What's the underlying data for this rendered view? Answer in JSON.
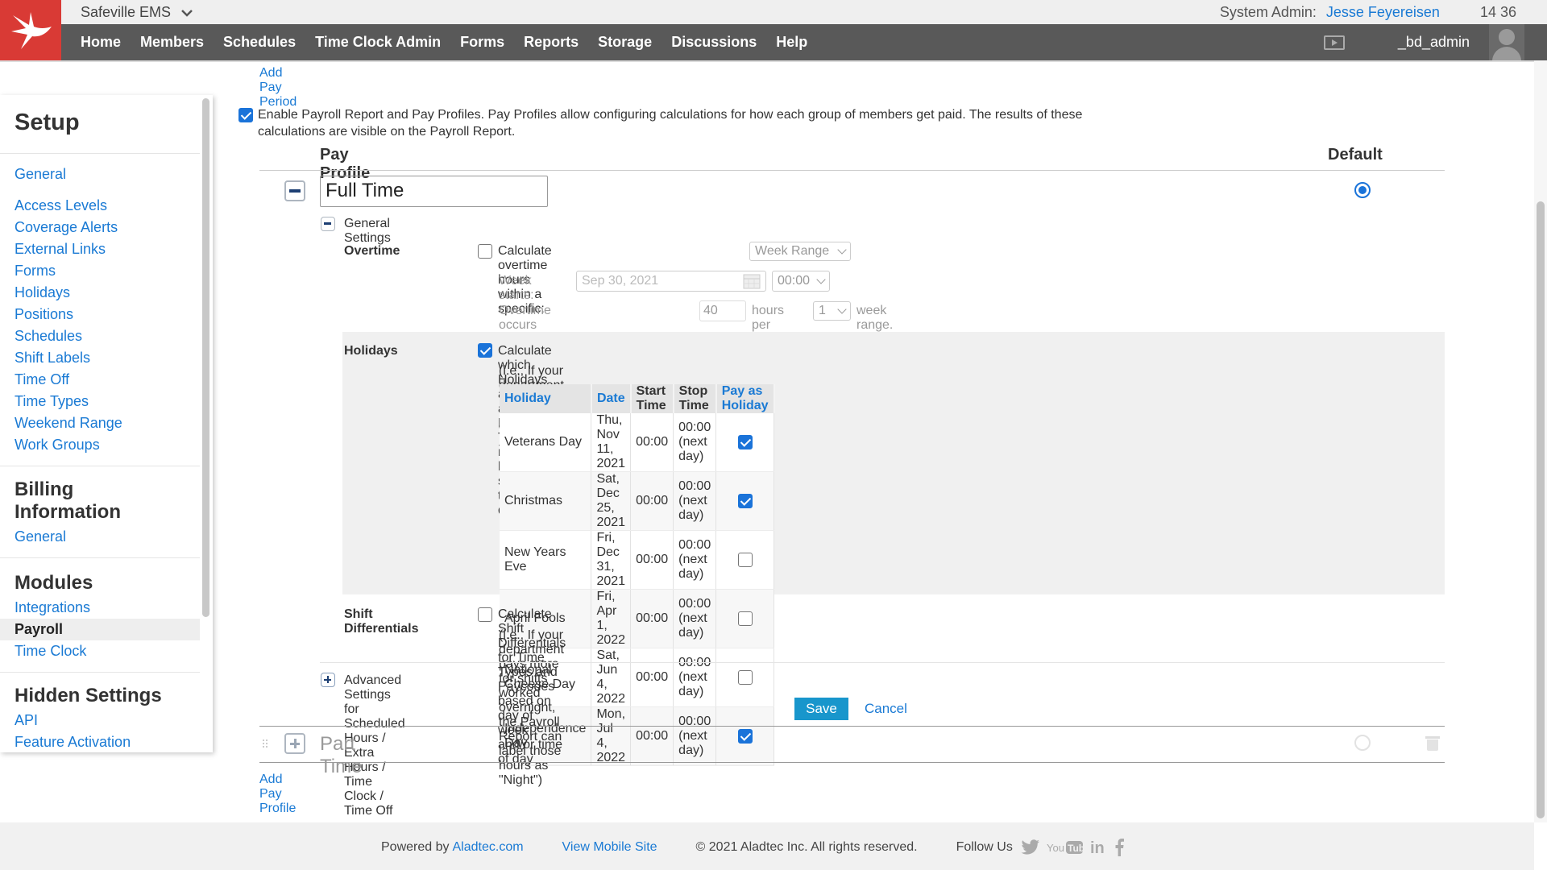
{
  "topbar": {
    "org_name": "Safeville EMS",
    "admin_label": "System Admin:",
    "admin_name": "Jesse Feyereisen",
    "time": "14 36"
  },
  "nav": {
    "items": [
      "Home",
      "Members",
      "Schedules",
      "Time Clock Admin",
      "Forms",
      "Reports",
      "Storage",
      "Discussions",
      "Help"
    ],
    "username": "_bd_admin"
  },
  "sidebar": {
    "title": "Setup",
    "setup_items": [
      "General",
      "Access Levels",
      "Coverage Alerts",
      "External Links",
      "Forms",
      "Holidays",
      "Positions",
      "Schedules",
      "Shift Labels",
      "Time Off",
      "Time Types",
      "Weekend Range",
      "Work Groups"
    ],
    "billing_title_1": "Billing",
    "billing_title_2": "Information",
    "billing_items": [
      "General"
    ],
    "modules_title": "Modules",
    "modules_items": [
      "Integrations",
      "Payroll",
      "Time Clock"
    ],
    "hidden_title": "Hidden Settings",
    "hidden_items": [
      "API",
      "Feature Activation"
    ]
  },
  "main": {
    "add_pay_period": "Add Pay Period",
    "enable_text_1": "Enable Payroll Report and Pay Profiles. Pay Profiles allow configuring calculations for how each group of members get paid. The results of these",
    "enable_text_2": "calculations are visible on the Payroll Report.",
    "pay_profile_header": "Pay Profile",
    "default_header": "Default",
    "profile_name": "Full Time",
    "general_settings": "General Settings",
    "overtime": {
      "label": "Overtime",
      "calc_text": "Calculate overtime hours within a specific:",
      "range_value": "Week Range",
      "week_starts_label": "Week starts:",
      "week_starts_value": "Sep 30, 2021",
      "time_value": "00:00",
      "occurs_text": "Overtime occurs when exceeding",
      "hours_value": "40",
      "hours_per": "hours per",
      "per_value": "1",
      "week_range_text": "week range."
    },
    "holidays": {
      "label": "Holidays",
      "calc_text": "Calculate which Holidays are paid as Holiday Time (if a member has a shift on that date)",
      "note": "(i.e., If your department pays more for shifts worked on July 4th, the Payroll Report will label those hours as \"Holiday\")",
      "columns": [
        "Holiday",
        "Date",
        "Start Time",
        "Stop Time",
        "Pay as Holiday"
      ],
      "rows": [
        {
          "holiday": "Veterans Day",
          "date": "Thu, Nov 11, 2021",
          "start": "00:00",
          "stop": "00:00 (next day)",
          "pay": true
        },
        {
          "holiday": "Christmas",
          "date": "Sat, Dec 25, 2021",
          "start": "00:00",
          "stop": "00:00 (next day)",
          "pay": true
        },
        {
          "holiday": "New Years Eve",
          "date": "Fri, Dec 31, 2021",
          "start": "00:00",
          "stop": "00:00 (next day)",
          "pay": false
        },
        {
          "holiday": "April Fools",
          "date": "Fri, Apr 1, 2022",
          "start": "00:00",
          "stop": "00:00 (next day)",
          "pay": false
        },
        {
          "holiday": "National Cheese Day",
          "date": "Sat, Jun 4, 2022",
          "start": "00:00",
          "stop": "00:00 (next day)",
          "pay": false
        },
        {
          "holiday": "Independence Day",
          "date": "Mon, Jul 4, 2022",
          "start": "00:00",
          "stop": "00:00 (next day)",
          "pay": true
        }
      ]
    },
    "shift_diff": {
      "label": "Shift Differentials",
      "calc_text": "Calculate Shift Differentials for Time Types and Paycodes based on day of week and/or time of day",
      "note": "(i.e., If your department pays more for shifts worked overnight, the Payroll Report can label those hours as \"Night\")"
    },
    "advanced": "Advanced Settings for Scheduled Hours / Extra Hours / Time Clock / Time Off",
    "save": "Save",
    "cancel": "Cancel",
    "part_time": "Part Time",
    "add_pay_profile": "Add Pay Profile"
  },
  "footer": {
    "powered_by": "Powered by",
    "powered_link": "Aladtec.com",
    "mobile": "View Mobile Site",
    "copyright": "© 2021 Aladtec Inc. All rights reserved.",
    "follow": "Follow Us"
  },
  "colors": {
    "brand_red": "#d93a35",
    "nav_bg": "#595959",
    "link_blue": "#1a7ad4",
    "save_blue": "#1896cc"
  }
}
